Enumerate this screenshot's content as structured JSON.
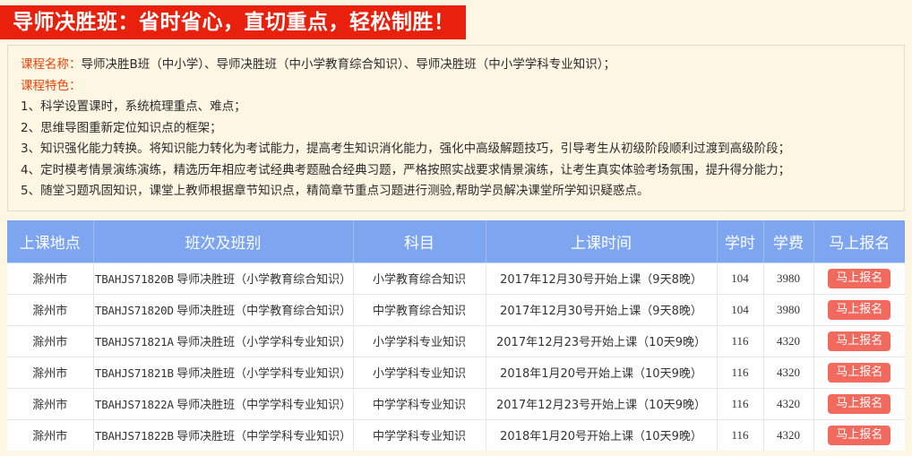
{
  "banner": {
    "title": "导师决胜班：省时省心，直切重点，轻松制胜！",
    "bg_color": "#e8200c",
    "text_color": "#ffffff"
  },
  "description": {
    "course_name_label": "课程名称：",
    "course_name_value": "导师决胜B班（中小学）、导师决胜班（中小学教育综合知识）、导师决胜班（中小学学科专业知识）；",
    "features_label": "课程特色：",
    "features": [
      "1、科学设置课时，系统梳理重点、难点；",
      "2、思维导图重新定位知识点的框架；",
      "3、知识强化能力转换。将知识能力转化为考试能力，提高考生知识消化能力，强化中高级解题技巧，引导考生从初级阶段顺利过渡到高级阶段；",
      "4、定时模考情景演练演练，精选历年相应考试经典考题融合经典习题，严格按照实战要求情景演练，让考生真实体验考场氛围，提升得分能力；",
      "5、随堂习题巩固知识，课堂上教师根据章节知识点，精简章节重点习题进行测验,帮助学员解决课堂所学知识疑惑点。"
    ],
    "label_color": "#e8450c"
  },
  "table": {
    "header_bg": "#7ea6f0",
    "headers": [
      "上课地点",
      "班次及班别",
      "科目",
      "上课时间",
      "学时",
      "学费",
      "马上报名"
    ],
    "button_color": "#f2695e",
    "rows": [
      {
        "location": "滁州市",
        "code": "TBAHJS71820B",
        "class_name": "导师决胜班（小学教育综合知识）",
        "subject": "小学教育综合知识",
        "time": "2017年12月30号开始上课（9天8晚）",
        "hours": "104",
        "fee": "3980",
        "action": "马上报名"
      },
      {
        "location": "滁州市",
        "code": "TBAHJS71820D",
        "class_name": "导师决胜班（中学教育综合知识）",
        "subject": "中学教育综合知识",
        "time": "2017年12月30号开始上课（9天8晚）",
        "hours": "104",
        "fee": "3980",
        "action": "马上报名"
      },
      {
        "location": "滁州市",
        "code": "TBAHJS71821A",
        "class_name": "导师决胜班（小学学科专业知识）",
        "subject": "小学学科专业知识",
        "time": "2017年12月23号开始上课（10天9晚）",
        "hours": "116",
        "fee": "4320",
        "action": "马上报名"
      },
      {
        "location": "滁州市",
        "code": "TBAHJS71821B",
        "class_name": "导师决胜班（小学学科专业知识）",
        "subject": "小学学科专业知识",
        "time": "2018年1月20号开始上课（10天9晚）",
        "hours": "116",
        "fee": "4320",
        "action": "马上报名"
      },
      {
        "location": "滁州市",
        "code": "TBAHJS71822A",
        "class_name": "导师决胜班（中学学科专业知识）",
        "subject": "中学学科专业知识",
        "time": "2017年12月23号开始上课（10天9晚）",
        "hours": "116",
        "fee": "4320",
        "action": "马上报名"
      },
      {
        "location": "滁州市",
        "code": "TBAHJS71822B",
        "class_name": "导师决胜班（中学学科专业知识）",
        "subject": "中学学科专业知识",
        "time": "2018年1月20号开始上课（10天9晚）",
        "hours": "116",
        "fee": "4320",
        "action": "马上报名"
      }
    ]
  }
}
